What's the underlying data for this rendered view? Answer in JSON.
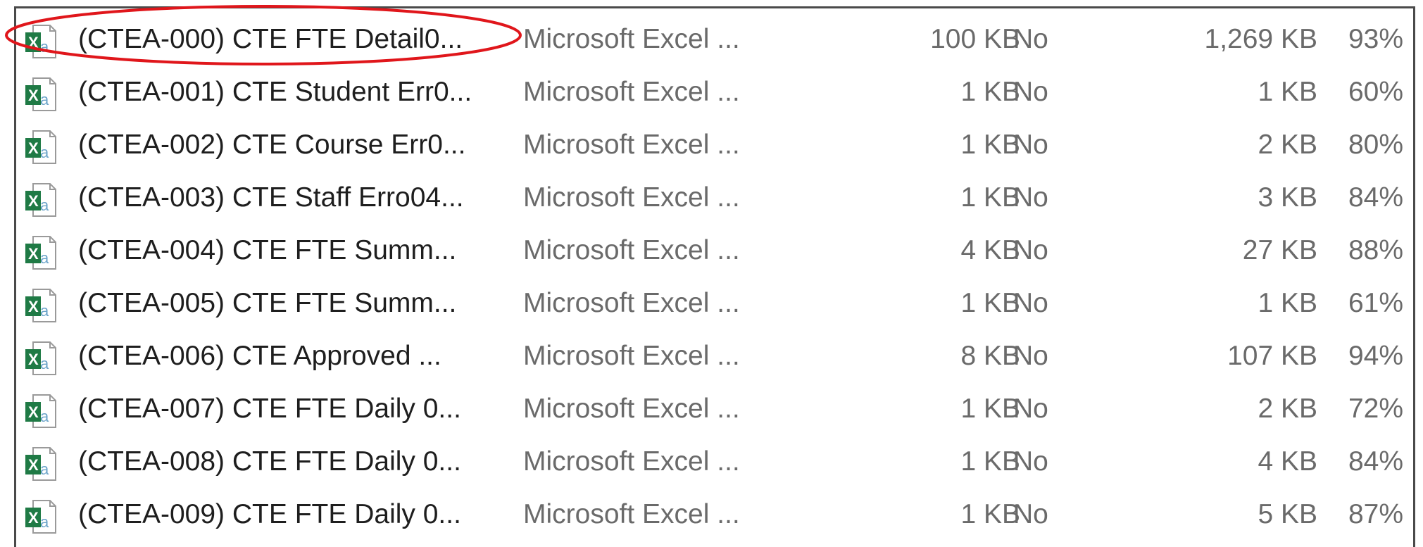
{
  "files": [
    {
      "name": "(CTEA-000) CTE FTE Detail0...",
      "type": "Microsoft Excel ...",
      "packed_size": "100 KB",
      "password_protected": "No",
      "size": "1,269 KB",
      "ratio": "93%"
    },
    {
      "name": "(CTEA-001) CTE Student Err0...",
      "type": "Microsoft Excel ...",
      "packed_size": "1 KB",
      "password_protected": "No",
      "size": "1 KB",
      "ratio": "60%"
    },
    {
      "name": "(CTEA-002) CTE Course Err0...",
      "type": "Microsoft Excel ...",
      "packed_size": "1 KB",
      "password_protected": "No",
      "size": "2 KB",
      "ratio": "80%"
    },
    {
      "name": "(CTEA-003) CTE Staff Erro04...",
      "type": "Microsoft Excel ...",
      "packed_size": "1 KB",
      "password_protected": "No",
      "size": "3 KB",
      "ratio": "84%"
    },
    {
      "name": "(CTEA-004) CTE FTE Summ...",
      "type": "Microsoft Excel ...",
      "packed_size": "4 KB",
      "password_protected": "No",
      "size": "27 KB",
      "ratio": "88%"
    },
    {
      "name": "(CTEA-005) CTE FTE Summ...",
      "type": "Microsoft Excel ...",
      "packed_size": "1 KB",
      "password_protected": "No",
      "size": "1 KB",
      "ratio": "61%"
    },
    {
      "name": "(CTEA-006) CTE Approved ...",
      "type": "Microsoft Excel ...",
      "packed_size": "8 KB",
      "password_protected": "No",
      "size": "107 KB",
      "ratio": "94%"
    },
    {
      "name": "(CTEA-007) CTE FTE Daily 0...",
      "type": "Microsoft Excel ...",
      "packed_size": "1 KB",
      "password_protected": "No",
      "size": "2 KB",
      "ratio": "72%"
    },
    {
      "name": "(CTEA-008) CTE FTE Daily 0...",
      "type": "Microsoft Excel ...",
      "packed_size": "1 KB",
      "password_protected": "No",
      "size": "4 KB",
      "ratio": "84%"
    },
    {
      "name": "(CTEA-009) CTE FTE Daily 0...",
      "type": "Microsoft Excel ...",
      "packed_size": "1 KB",
      "password_protected": "No",
      "size": "5 KB",
      "ratio": "87%"
    }
  ],
  "file_icon": "excel-file-icon",
  "highlight": {
    "row": 0,
    "color": "#e0161b"
  },
  "colors": {
    "excel_green": "#1f7a45",
    "text": "#3c3c3c"
  }
}
